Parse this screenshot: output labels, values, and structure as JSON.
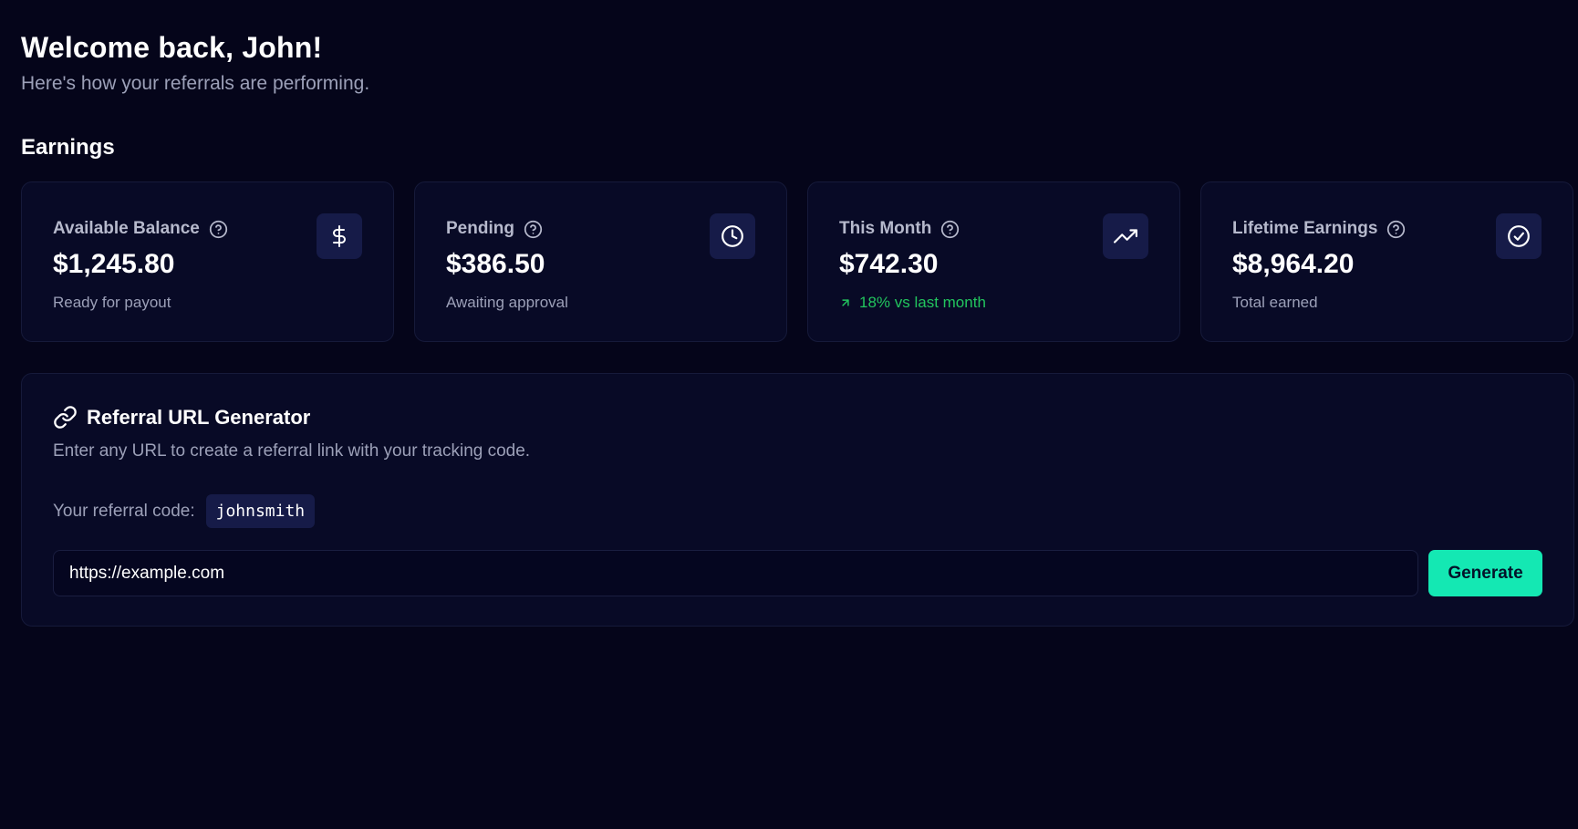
{
  "header": {
    "title": "Welcome back, John!",
    "subtitle": "Here's how your referrals are performing."
  },
  "earnings": {
    "section_title": "Earnings",
    "cards": [
      {
        "label": "Available Balance",
        "value": "$1,245.80",
        "note": "Ready for payout",
        "icon": "dollar-icon"
      },
      {
        "label": "Pending",
        "value": "$386.50",
        "note": "Awaiting approval",
        "icon": "clock-icon"
      },
      {
        "label": "This Month",
        "value": "$742.30",
        "note": "18% vs last month",
        "note_trend": "up",
        "icon": "trending-up-icon"
      },
      {
        "label": "Lifetime Earnings",
        "value": "$8,964.20",
        "note": "Total earned",
        "icon": "check-circle-icon"
      }
    ]
  },
  "generator": {
    "title": "Referral URL Generator",
    "description": "Enter any URL to create a referral link with your tracking code.",
    "code_label": "Your referral code:",
    "code": "johnsmith",
    "input_value": "https://example.com",
    "button_label": "Generate"
  },
  "colors": {
    "background": "#05051a",
    "card": "#080a26",
    "accent": "#14e8b3",
    "positive": "#22c55e",
    "muted_text": "#9ca0b8"
  }
}
